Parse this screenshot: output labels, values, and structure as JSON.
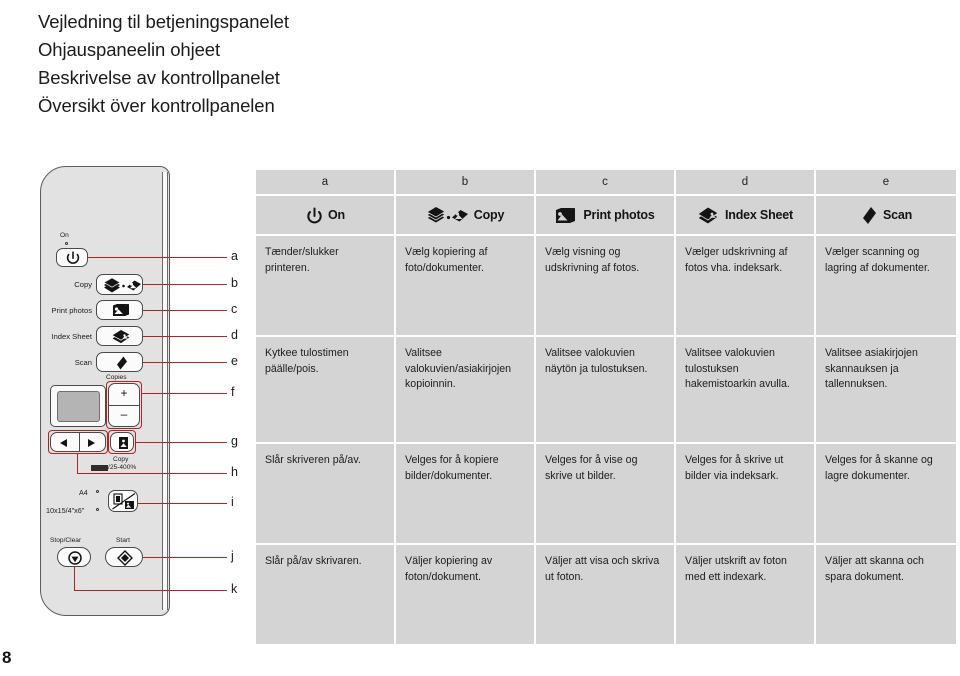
{
  "titles": [
    "Vejledning til betjeningspanelet",
    "Ohjauspaneelin ohjeet",
    "Beskrivelse av kontrollpanelet",
    "Översikt över kontrollpanelen"
  ],
  "page_number": "8",
  "panel": {
    "labels": {
      "on": "On",
      "copy": "Copy",
      "print_photos": "Print photos",
      "index_sheet": "Index Sheet",
      "scan": "Scan",
      "copies": "Copies",
      "plus": "+",
      "minus": "–",
      "copy_zoom": "Copy",
      "copy_zoom_range": "/25-400%",
      "paper_a4": "A4",
      "paper_10x15": "10x15/4\"x6\"",
      "stop_clear": "Stop/Clear",
      "start": "Start"
    },
    "callouts": [
      "a",
      "b",
      "c",
      "d",
      "e",
      "f",
      "g",
      "h",
      "i",
      "j",
      "k"
    ],
    "icons": {
      "power": "power-icon",
      "copy": "copy-icon",
      "print_photos": "print-photos-icon",
      "index_sheet": "index-sheet-icon",
      "scan": "scan-icon",
      "left_arrow": "left-arrow-icon",
      "right_arrow": "right-arrow-icon",
      "zoom_fit": "zoom-fit-icon",
      "paper_type": "paper-type-icon",
      "stop": "stop-icon",
      "start": "start-diamond-icon"
    },
    "accent_color": "#b22222",
    "body_color": "#e2e2e2"
  },
  "table": {
    "columns": [
      {
        "letter": "a",
        "icon": "power-icon",
        "icon_label": "On",
        "da": "Tænder/slukker printeren.",
        "fi": "Kytkee tulostimen päälle/pois.",
        "no": "Slår skriveren på/av.",
        "sv": "Slår på/av skrivaren."
      },
      {
        "letter": "b",
        "icon": "copy-icon",
        "icon_label": "Copy",
        "da": "Vælg kopiering af foto/dokumenter.",
        "fi": "Valitsee valokuvien/asiakirjojen kopioinnin.",
        "no": "Velges for å kopiere bilder/dokumenter.",
        "sv": "Väljer kopiering av foton/dokument."
      },
      {
        "letter": "c",
        "icon": "print-photos-icon",
        "icon_label": "Print photos",
        "da": "Vælg visning og udskrivning af fotos.",
        "fi": "Valitsee valokuvien näytön ja tulostuksen.",
        "no": "Velges for å vise og skrive ut bilder.",
        "sv": "Väljer att visa och skriva ut foton."
      },
      {
        "letter": "d",
        "icon": "index-sheet-icon",
        "icon_label": "Index Sheet",
        "da": "Vælger udskrivning af fotos vha. indeksark.",
        "fi": "Valitsee valokuvien tulostuksen hakemistoarkin avulla.",
        "no": "Velges for å skrive ut bilder via indeksark.",
        "sv": "Väljer utskrift av foton med ett indexark."
      },
      {
        "letter": "e",
        "icon": "scan-icon",
        "icon_label": "Scan",
        "da": "Vælger scanning og lagring af dokumenter.",
        "fi": "Valitsee asiakirjojen skannauksen ja tallennuksen.",
        "no": "Velges for å skanne og lagre dokumenter.",
        "sv": "Väljer att skanna och spara dokument."
      }
    ]
  }
}
